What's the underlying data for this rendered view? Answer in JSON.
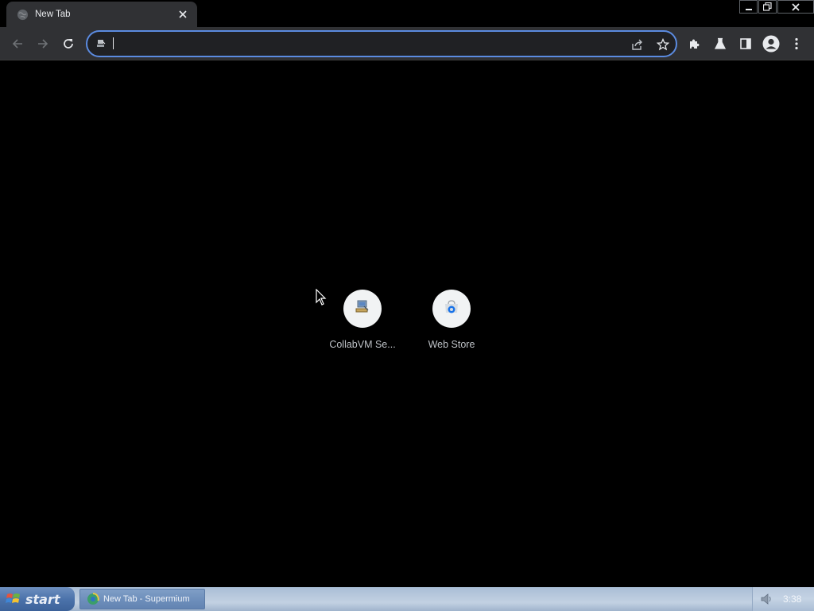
{
  "browser": {
    "tab": {
      "title": "New Tab",
      "favicon": "globe-icon",
      "close_icon": "close-icon"
    },
    "window_controls": {
      "minimize_icon": "minimize-icon",
      "restore_icon": "restore-icon",
      "close_icon": "close-icon"
    },
    "toolbar": {
      "back_icon": "back-arrow-icon",
      "forward_icon": "forward-arrow-icon",
      "reload_icon": "reload-icon",
      "omnibox": {
        "value": "",
        "placeholder": "",
        "site_icon": "collabvm-icon",
        "share_icon": "share-icon",
        "bookmark_icon": "star-icon"
      },
      "extensions_icon": "puzzle-icon",
      "labs_icon": "flask-icon",
      "side_panel_icon": "side-panel-icon",
      "profile_icon": "avatar-icon",
      "menu_icon": "kebab-menu-icon"
    }
  },
  "new_tab": {
    "shortcuts": [
      {
        "label": "CollabVM Se...",
        "icon": "collabvm-icon"
      },
      {
        "label": "Web Store",
        "icon": "web-store-icon"
      }
    ]
  },
  "taskbar": {
    "start_label": "start",
    "tasks": [
      {
        "label": "New Tab - Supermium",
        "icon": "supermium-icon"
      }
    ],
    "tray": {
      "clock": "3:38",
      "sound_icon": "speaker-icon"
    }
  },
  "colors": {
    "page_background": "#000000",
    "toolbar": "#303134",
    "omnibox_focus_ring": "#5b8be0",
    "taskbar": "#b7c8dc"
  }
}
